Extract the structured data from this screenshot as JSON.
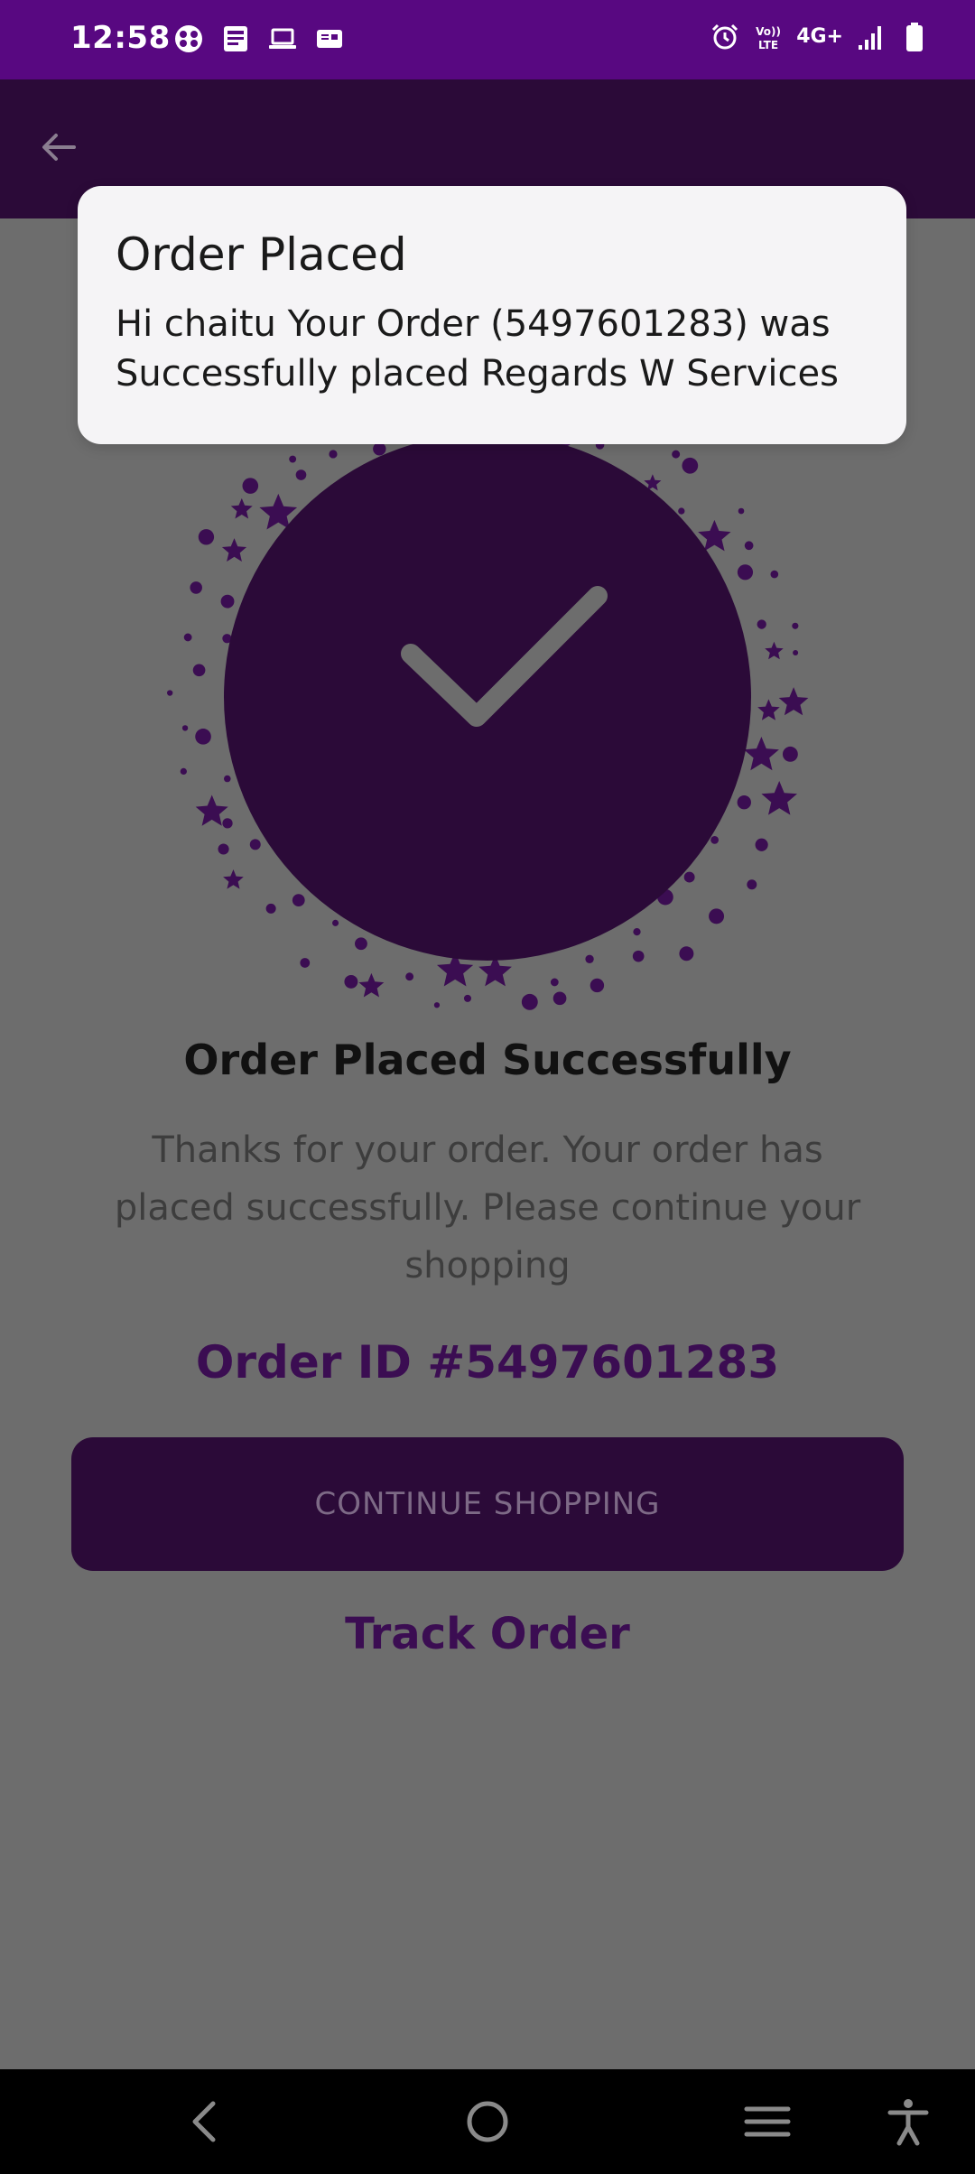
{
  "status_bar": {
    "time": "12:58",
    "network_label": "4G+",
    "left_icons": [
      "app-icon",
      "news-icon",
      "laptop-icon",
      "gallery-icon"
    ],
    "right_icons": [
      "alarm-icon",
      "volte-icon",
      "signal-icon",
      "battery-icon"
    ]
  },
  "app_bar": {
    "back_icon": "back-arrow-icon"
  },
  "notification": {
    "title": "Order Placed",
    "body": "Hi chaitu Your Order (5497601283) was Successfully placed Regards W Services"
  },
  "main": {
    "title": "Order Placed Successfully",
    "message": "Thanks for your order. Your order has placed successfully. Please continue your shopping",
    "order_id": "Order ID #5497601283",
    "continue_button": "CONTINUE SHOPPING",
    "track_order": "Track Order"
  },
  "nav_bar": {
    "icons": [
      "nav-back-icon",
      "home-icon",
      "recents-icon",
      "accessibility-icon"
    ]
  },
  "colors": {
    "status_bar": "#580881",
    "app_bar": "#2b0a38",
    "scrim_background": "#6d6d6d",
    "accent": "#3b0d52"
  }
}
